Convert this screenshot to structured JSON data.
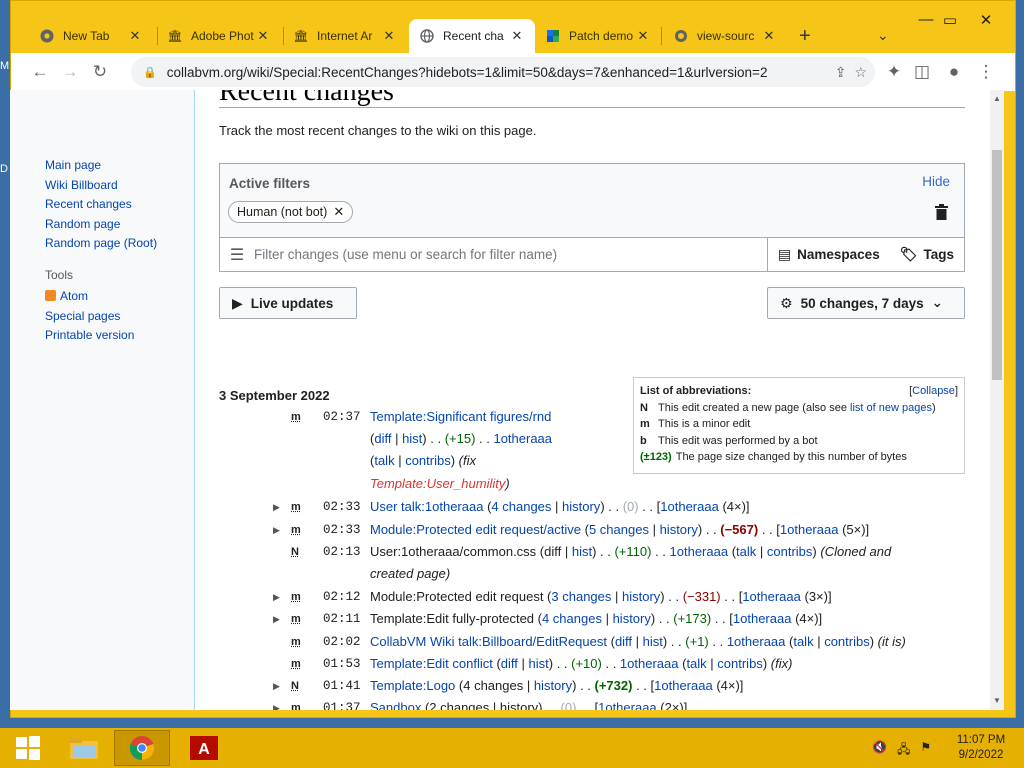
{
  "desktop": {
    "glyph_top": "M",
    "glyph_mid": "D"
  },
  "browser": {
    "tabs": [
      {
        "label": "New Tab",
        "icon": "chrome-icon"
      },
      {
        "label": "Adobe Phot",
        "icon": "archive-icon"
      },
      {
        "label": "Internet Ar",
        "icon": "archive-icon"
      },
      {
        "label": "Recent cha",
        "icon": "globe-icon",
        "active": true
      },
      {
        "label": "Patch demo",
        "icon": "patch-icon"
      },
      {
        "label": "view-sourc",
        "icon": "globe-icon"
      }
    ],
    "url": "collabvm.org/wiki/Special:RecentChanges?hidebots=1&limit=50&days=7&enhanced=1&urlversion=2",
    "accent_color": "#f5c518"
  },
  "sidebar": {
    "nav": [
      "Main page",
      "Wiki Billboard",
      "Recent changes",
      "Random page",
      "Random page (Root)"
    ],
    "tools_heading": "Tools",
    "tools": [
      "Atom",
      "Special pages",
      "Printable version"
    ]
  },
  "main": {
    "title": "Recent changes",
    "intro": "Track the most recent changes to the wiki on this page.",
    "filters": {
      "title": "Active filters",
      "hide_label": "Hide",
      "chip": "Human (not bot)",
      "placeholder": "Filter changes (use menu or search for filter name)",
      "namespaces": "Namespaces",
      "tags": "Tags"
    },
    "live_updates": "Live updates",
    "options": "50 changes, 7 days",
    "abbrev": {
      "heading": "List of abbreviations:",
      "collapse": "Collapse",
      "n_key": "N",
      "n_text": "This edit created a new page (also see ",
      "n_link": "list of new pages",
      "n_end": ")",
      "m_key": "m",
      "m_text": "This is a minor edit",
      "b_key": "b",
      "b_text": "This edit was performed by a bot",
      "p_key": "(±123)",
      "p_text": "The page size changed by this number of bytes"
    },
    "date": "3 September 2022"
  },
  "taskbar": {
    "time": "11:07 PM",
    "date": "9/2/2022"
  }
}
